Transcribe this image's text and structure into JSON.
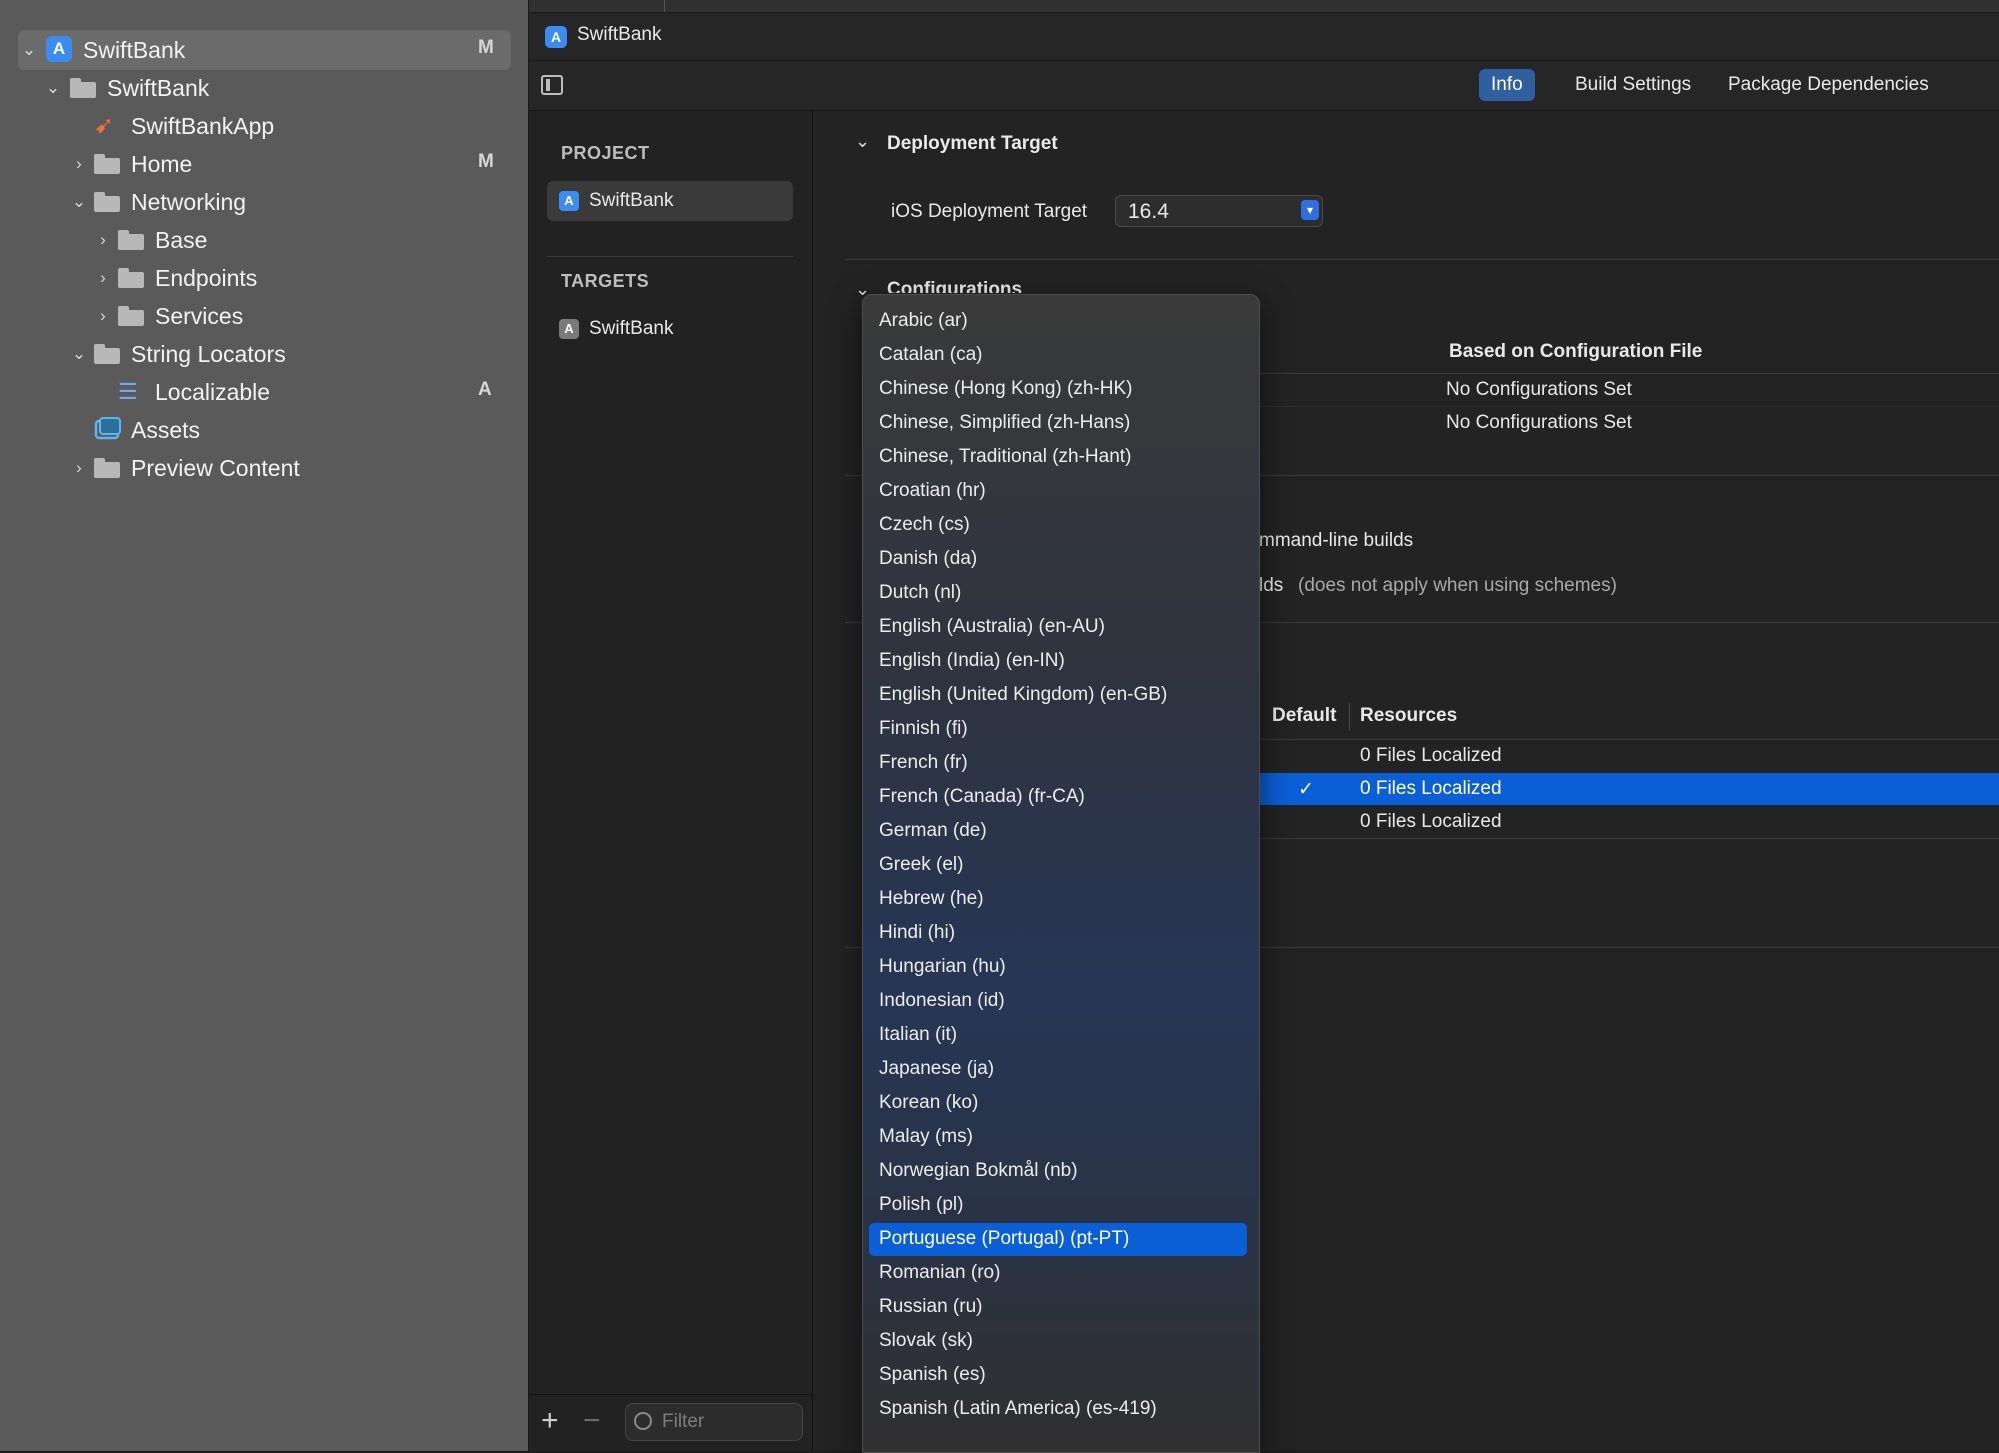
{
  "navigator": {
    "items": [
      {
        "label": "SwiftBank",
        "status": "M"
      },
      {
        "label": "SwiftBank",
        "status": ""
      },
      {
        "label": "SwiftBankApp",
        "status": ""
      },
      {
        "label": "Home",
        "status": "M"
      },
      {
        "label": "Networking",
        "status": ""
      },
      {
        "label": "Base",
        "status": ""
      },
      {
        "label": "Endpoints",
        "status": ""
      },
      {
        "label": "Services",
        "status": ""
      },
      {
        "label": "String Locators",
        "status": ""
      },
      {
        "label": "Localizable",
        "status": "A"
      },
      {
        "label": "Assets",
        "status": ""
      },
      {
        "label": "Preview Content",
        "status": ""
      }
    ]
  },
  "jump_bar": {
    "title": "SwiftBank"
  },
  "toolbar": {
    "tabs": [
      "Info",
      "Build Settings",
      "Package Dependencies"
    ],
    "active_tab": "Info"
  },
  "project_list": {
    "project_header": "PROJECT",
    "project_item": "SwiftBank",
    "targets_header": "TARGETS",
    "target_item": "SwiftBank",
    "filter_placeholder": "Filter"
  },
  "detail": {
    "deployment": {
      "title": "Deployment Target",
      "label": "iOS Deployment Target",
      "value": "16.4"
    },
    "configurations": {
      "title": "Configurations",
      "col_based_on": "Based on Configuration File",
      "rows": [
        "No Configurations Set",
        "No Configurations Set"
      ]
    },
    "commandline": {
      "line1": "mmand-line builds",
      "line2_prefix": "lds",
      "line2_note": "(does not apply when using schemes)"
    },
    "localizations": {
      "col_default": "Default",
      "col_resources": "Resources",
      "rows": [
        {
          "resources": "0 Files Localized",
          "check": ""
        },
        {
          "resources": "0 Files Localized",
          "check": "✓"
        },
        {
          "resources": "0 Files Localized",
          "check": ""
        }
      ]
    }
  },
  "menu": {
    "items": [
      "Arabic (ar)",
      "Catalan (ca)",
      "Chinese (Hong Kong) (zh-HK)",
      "Chinese, Simplified (zh-Hans)",
      "Chinese, Traditional (zh-Hant)",
      "Croatian (hr)",
      "Czech (cs)",
      "Danish (da)",
      "Dutch (nl)",
      "English (Australia) (en-AU)",
      "English (India) (en-IN)",
      "English (United Kingdom) (en-GB)",
      "Finnish (fi)",
      "French (fr)",
      "French (Canada) (fr-CA)",
      "German (de)",
      "Greek (el)",
      "Hebrew (he)",
      "Hindi (hi)",
      "Hungarian (hu)",
      "Indonesian (id)",
      "Italian (it)",
      "Japanese (ja)",
      "Korean (ko)",
      "Malay (ms)",
      "Norwegian Bokmål (nb)",
      "Polish (pl)",
      "Portuguese (Portugal) (pt-PT)",
      "Romanian (ro)",
      "Russian (ru)",
      "Slovak (sk)",
      "Spanish (es)",
      "Spanish (Latin America) (es-419)"
    ],
    "highlighted_index": 27
  },
  "colors": {
    "accent": "#0a5fd6",
    "navigator_bg": "#5a5a5a",
    "editor_bg": "#232323"
  }
}
